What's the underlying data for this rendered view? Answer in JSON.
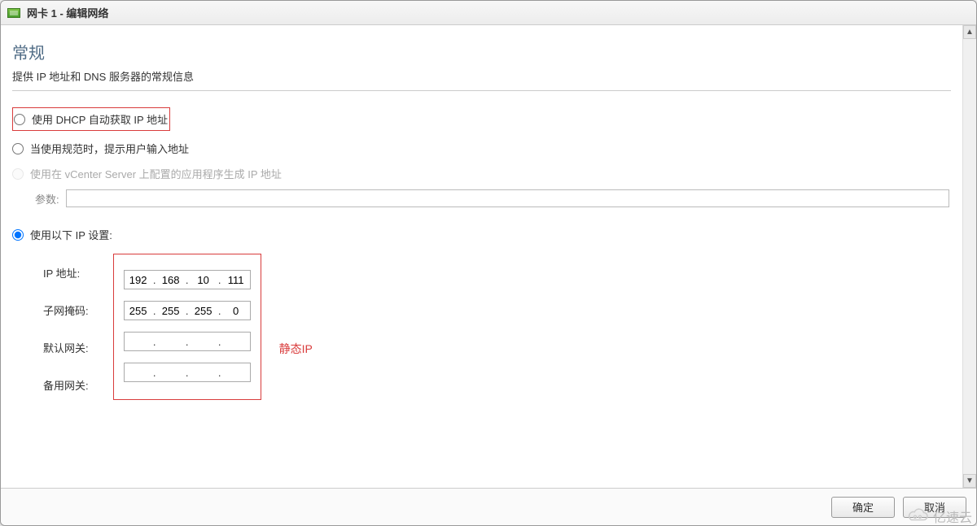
{
  "window": {
    "title": "网卡 1 - 编辑网络"
  },
  "section": {
    "title": "常规",
    "desc": "提供 IP 地址和 DNS 服务器的常规信息"
  },
  "radios": {
    "dhcp": "使用 DHCP 自动获取 IP 地址",
    "prompt": "当使用规范时，提示用户输入地址",
    "vcenter": "使用在 vCenter Server 上配置的应用程序生成 IP 地址",
    "param_label": "参数:",
    "param_value": "",
    "manual": "使用以下 IP 设置:"
  },
  "ip_fields": {
    "ip_label": "IP 地址:",
    "subnet_label": "子网掩码:",
    "gateway_label": "默认网关:",
    "alt_gateway_label": "备用网关:",
    "ip": {
      "o1": "192",
      "o2": "168",
      "o3": "10",
      "o4": "111"
    },
    "subnet": {
      "o1": "255",
      "o2": "255",
      "o3": "255",
      "o4": "0"
    },
    "gateway": {
      "o1": "",
      "o2": "",
      "o3": "",
      "o4": ""
    },
    "alt_gateway": {
      "o1": "",
      "o2": "",
      "o3": "",
      "o4": ""
    },
    "dot": "."
  },
  "annotation": {
    "static_ip": "静态IP"
  },
  "footer": {
    "ok": "确定",
    "cancel": "取消"
  },
  "watermark": "亿速云"
}
